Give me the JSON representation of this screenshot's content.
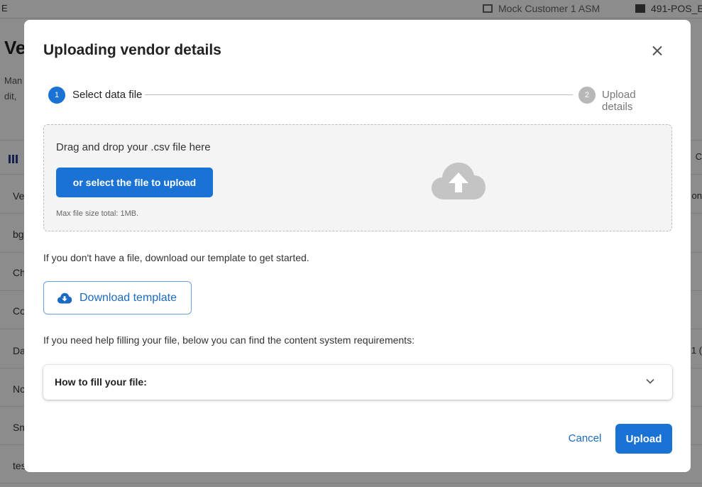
{
  "background": {
    "left_mark": "E",
    "customer": "Mock Customer 1 ASM",
    "pos": "491-POS_E",
    "title_partial": "Ve",
    "desc_lines": [
      "Man",
      "dit,"
    ],
    "right_col_header": "C",
    "table_rows": [
      {
        "left": "Ve",
        "right": "on"
      },
      {
        "left": "bg",
        "right": ""
      },
      {
        "left": "Ch",
        "right": ""
      },
      {
        "left": "Co",
        "right": ""
      },
      {
        "left": "Da",
        "right": "1 ("
      },
      {
        "left": "No",
        "right": ""
      },
      {
        "left": "Sm",
        "right": ""
      },
      {
        "left": "tes",
        "right": ""
      }
    ]
  },
  "modal": {
    "title": "Uploading vendor details",
    "steps": [
      {
        "number": "1",
        "label": "Select data file",
        "state": "active"
      },
      {
        "number": "2",
        "label": "Upload details",
        "state": "inactive"
      }
    ],
    "dropzone": {
      "instruction": "Drag and drop your .csv file here",
      "select_button": "or select the file to upload",
      "max_size_hint": "Max file size total: 1MB.",
      "icon": "cloud-upload-icon"
    },
    "template_text": "If you don't have a file, download our template to get started.",
    "download_button": "Download template",
    "help_text": "If you need help filling your file, below you can find the content system requirements:",
    "accordion_label": "How to fill your file:",
    "cancel_button": "Cancel",
    "upload_button": "Upload"
  },
  "colors": {
    "primary": "#1a73d4",
    "link": "#1a6ac2",
    "step_inactive": "#b8b8b8",
    "dropzone_bg": "#f4f4f4",
    "backdrop": "rgba(0,0,0,0.45)"
  }
}
